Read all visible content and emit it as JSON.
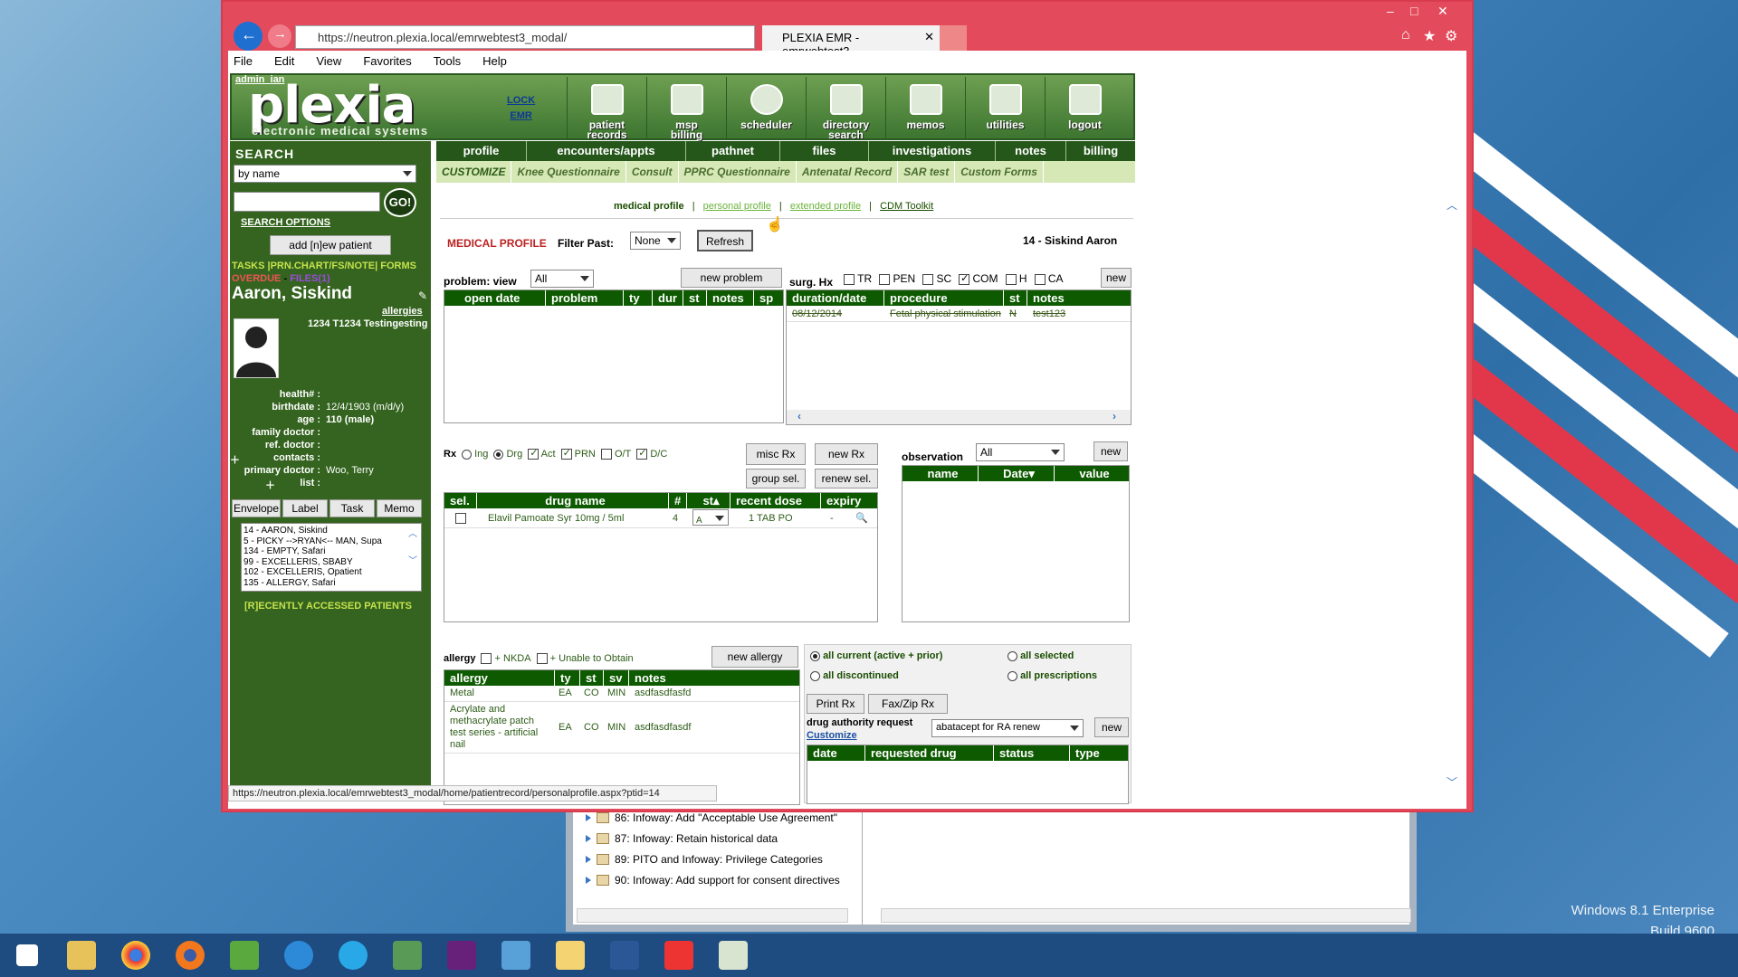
{
  "browser": {
    "url": "https://neutron.plexia.local/emrwebtest3_modal/",
    "tab_title": "PLEXIA EMR - emrwebtest3...",
    "menus": [
      "File",
      "Edit",
      "View",
      "Favorites",
      "Tools",
      "Help"
    ]
  },
  "header": {
    "user": "admin_ian",
    "logo": "plexia",
    "logo_sub": "electronic medical systems",
    "lock1": "LOCK",
    "lock2": "EMR",
    "icons": [
      {
        "label": "patient\nrecords",
        "icon": "folder-icon"
      },
      {
        "label": "msp\nbilling",
        "icon": "dollar-icon"
      },
      {
        "label": "scheduler",
        "icon": "clock-icon"
      },
      {
        "label": "directory\nsearch",
        "icon": "person-icon"
      },
      {
        "label": "memos",
        "icon": "memo-icon"
      },
      {
        "label": "utilities",
        "icon": "tools-icon"
      },
      {
        "label": "logout",
        "icon": "logout-icon"
      }
    ]
  },
  "sidebar": {
    "search_title": "SEARCH",
    "search_by": "by name",
    "go": "GO!",
    "search_options": "SEARCH OPTIONS",
    "add_patient": "add [n]ew patient",
    "links": "TASKS |PRN.CHART/FS/NOTE| FORMS",
    "overdue": "OVERDUE",
    "files": "FILES(1)",
    "patient_name": "Aaron, Siskind",
    "allergies": "allergies",
    "address": "1234 T1234 Testingesting",
    "fields": [
      {
        "k": "health# :",
        "v": ""
      },
      {
        "k": "birthdate :",
        "v": "12/4/1903 (m/d/y)"
      },
      {
        "k": "age :",
        "v": "110 (male)"
      },
      {
        "k": "family doctor :",
        "v": ""
      },
      {
        "k": "ref. doctor :",
        "v": ""
      },
      {
        "k": "contacts :",
        "v": ""
      },
      {
        "k": "primary doctor :",
        "v": "Woo, Terry"
      },
      {
        "k": "list :",
        "v": ""
      }
    ],
    "buttons": [
      "Envelope",
      "Label",
      "Task",
      "Memo"
    ],
    "recent": [
      "14 - AARON, Siskind",
      "5 - PICKY -->RYAN<-- MAN, Supa",
      "134 - EMPTY, Safari",
      "99 - EXCELLERIS, SBABY",
      "102 - EXCELLERIS, Opatient",
      "135 - ALLERGY, Safari"
    ],
    "recent_label": "[R]ECENTLY ACCESSED PATIENTS"
  },
  "main_tabs": [
    "profile",
    "encounters/appts",
    "pathnet",
    "files",
    "investigations",
    "notes",
    "billing"
  ],
  "sub_tabs": [
    "CUSTOMIZE",
    "Knee Questionnaire",
    "Consult",
    "PPRC Questionnaire",
    "Antenatal Record",
    "SAR test",
    "Custom Forms"
  ],
  "profile_links": {
    "medical": "medical profile",
    "personal": "personal profile",
    "extended": "extended profile",
    "cdm": "CDM Toolkit",
    "sep": "|"
  },
  "medical": {
    "title": "MEDICAL PROFILE",
    "filter_label": "Filter Past:",
    "filter_value": "None",
    "refresh": "Refresh",
    "patient": "14 - Siskind Aaron"
  },
  "problem": {
    "label": "problem: view",
    "view": "All",
    "new_btn": "new problem",
    "cols": [
      "open date",
      "problem",
      "ty",
      "dur",
      "st",
      "notes",
      "sp"
    ]
  },
  "surg": {
    "label": "surg. Hx",
    "checks": [
      {
        "l": "TR",
        "on": false
      },
      {
        "l": "PEN",
        "on": false
      },
      {
        "l": "SC",
        "on": false
      },
      {
        "l": "COM",
        "on": true
      },
      {
        "l": "H",
        "on": false
      },
      {
        "l": "CA",
        "on": false
      }
    ],
    "new_btn": "new",
    "cols": [
      "duration/date",
      "procedure",
      "st",
      "notes"
    ],
    "rows": [
      [
        "08/12/2014",
        "Fetal physical stimulation",
        "N",
        "test123"
      ]
    ]
  },
  "rx": {
    "label": "Rx",
    "opts": [
      {
        "l": "Ing",
        "on": false
      },
      {
        "l": "Drg",
        "on": true
      }
    ],
    "checks": [
      {
        "l": "Act",
        "on": true
      },
      {
        "l": "PRN",
        "on": true
      },
      {
        "l": "O/T",
        "on": false
      },
      {
        "l": "D/C",
        "on": true
      }
    ],
    "misc": "misc Rx",
    "new": "new Rx",
    "group": "group sel.",
    "renew": "renew sel.",
    "cols": [
      "sel.",
      "drug name",
      "#",
      "st▴",
      "recent dose",
      "expiry"
    ],
    "rows": [
      {
        "name": "Elavil Pamoate Syr 10mg / 5ml",
        "n": "4",
        "st": "A",
        "dose": "1 TAB PO",
        "exp": "-"
      }
    ]
  },
  "observation": {
    "label": "observation",
    "view": "All",
    "new_btn": "new",
    "cols": [
      "name",
      "Date▾",
      "value"
    ]
  },
  "allergy": {
    "label": "allergy",
    "nkda": "+ NKDA",
    "unable": "+ Unable to Obtain",
    "new_btn": "new allergy",
    "cols": [
      "allergy",
      "ty",
      "st",
      "sv",
      "notes"
    ],
    "rows": [
      [
        "Metal",
        "EA",
        "CO",
        "MIN",
        "asdfasdfasfd"
      ],
      [
        "Acrylate and methacrylate patch test series - artificial nail",
        "EA",
        "CO",
        "MIN",
        "asdfasdfasdf"
      ]
    ]
  },
  "prescriptions": {
    "opts": [
      {
        "l": "all current (active + prior)",
        "on": true
      },
      {
        "l": "all selected",
        "on": false
      },
      {
        "l": "all discontinued",
        "on": false
      },
      {
        "l": "all prescriptions",
        "on": false
      }
    ],
    "print": "Print Rx",
    "fax": "Fax/Zip Rx",
    "dar": "drug authority request",
    "customize": "Customize",
    "dar_value": "abatacept for RA renew",
    "new_btn": "new",
    "cols": [
      "date",
      "requested drug",
      "status",
      "type"
    ]
  },
  "status_url": "https://neutron.plexia.local/emrwebtest3_modal/home/patientrecord/personalprofile.aspx?ptid=14",
  "behind": {
    "items": [
      "86: Infoway: Add \"Acceptable Use Agreement\"",
      "87: Infoway: Retain historical data",
      "89: PITO and Infoway: Privilege Categories",
      "90: Infoway: Add support for consent directives"
    ]
  },
  "watermark": {
    "line1": "Windows 8.1 Enterprise",
    "line2": "Build 9600"
  }
}
